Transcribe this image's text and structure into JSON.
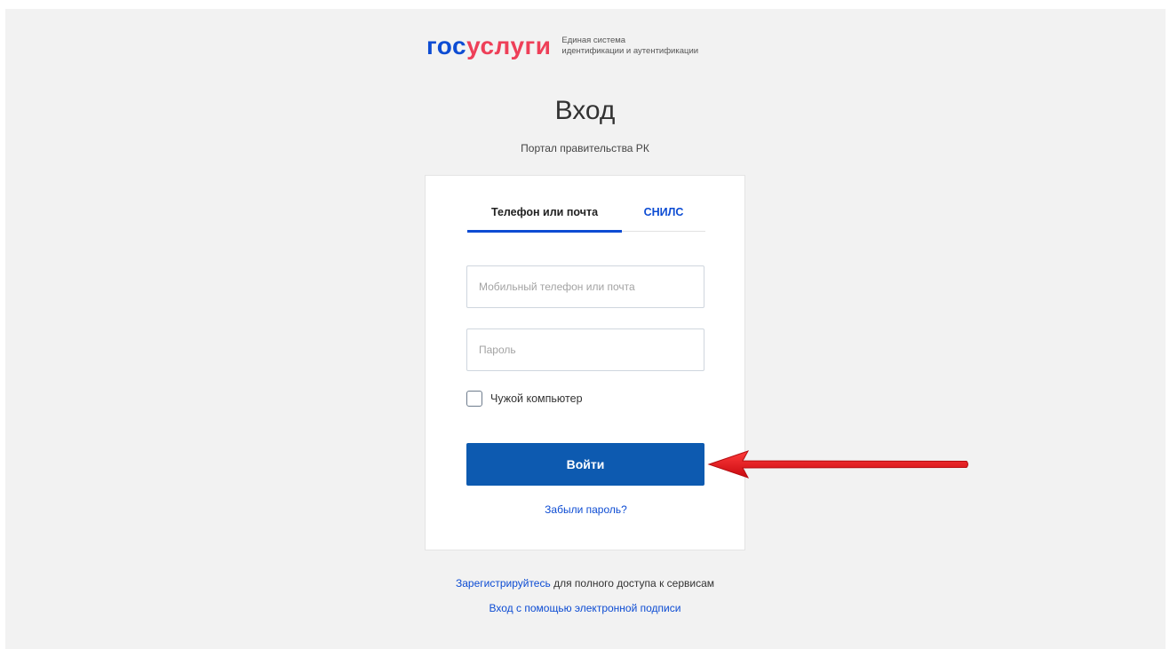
{
  "header": {
    "logo_part1": "гос",
    "logo_part2": "услуги",
    "tagline_line1": "Единая система",
    "tagline_line2": "идентификации и аутентификации"
  },
  "title": "Вход",
  "subtitle": "Портал правительства РК",
  "tabs": [
    {
      "label": "Телефон или почта",
      "active": true
    },
    {
      "label": "СНИЛС",
      "active": false
    }
  ],
  "form": {
    "login_placeholder": "Мобильный телефон или почта",
    "password_placeholder": "Пароль",
    "checkbox_label": "Чужой компьютер",
    "checkbox_checked": false,
    "submit_label": "Войти",
    "forgot_label": "Забыли пароль?"
  },
  "footer": {
    "register_link": "Зарегистрируйтесь",
    "register_text": " для полного доступа к сервисам",
    "esign_link": "Вход с помощью электронной подписи"
  },
  "colors": {
    "brand_blue": "#0d4cd3",
    "brand_red": "#ee3f58",
    "button": "#0d5ab0",
    "annotation_arrow": "#e8141c"
  },
  "icons": {
    "annotation": "red-arrow-left-icon"
  }
}
